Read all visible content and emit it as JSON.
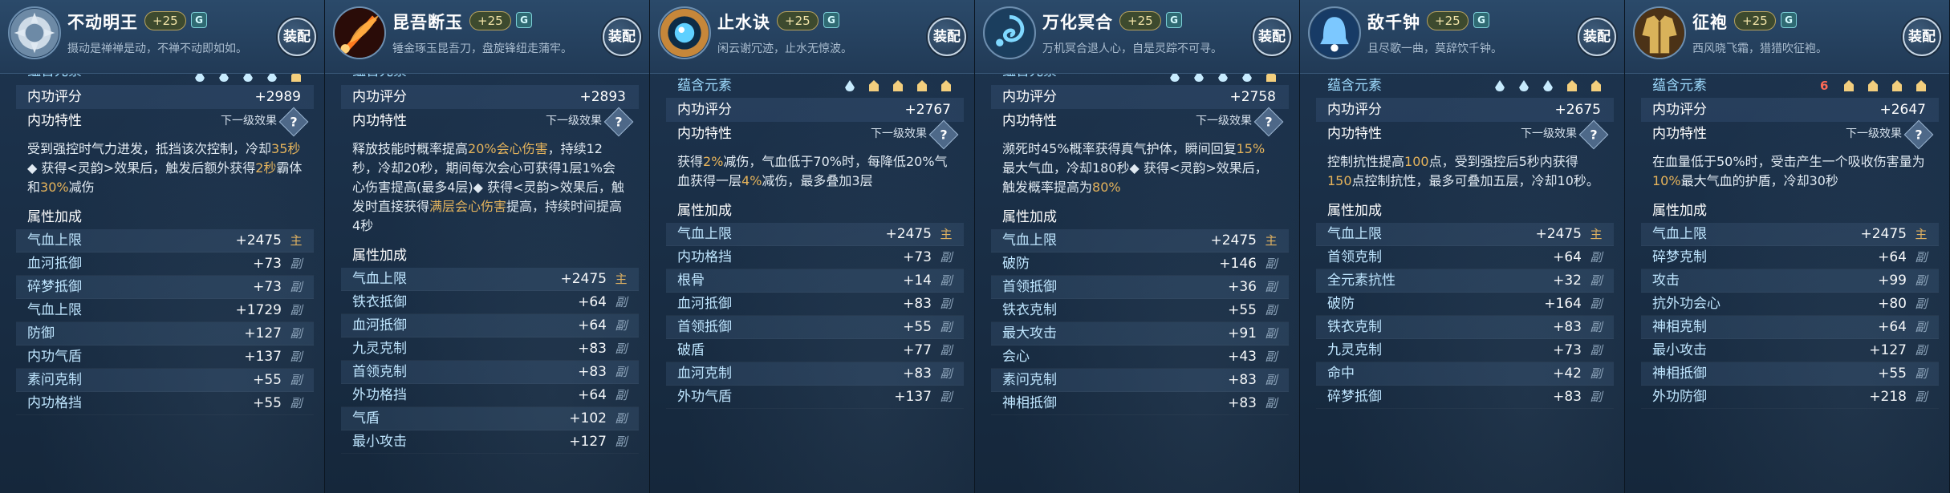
{
  "ui": {
    "equip_label": "装配",
    "element_label": "蕴含元素",
    "score_label": "内功评分",
    "trait_label": "内功特性",
    "next_label": "下一级效果",
    "attr_header": "属性加成",
    "qmark": "?",
    "tag_main": "主",
    "tag_sub": "副"
  },
  "panels": [
    {
      "name": "不动明王",
      "level": "+25",
      "grade": "G",
      "desc": "摄动是禅禅是动，不禅不动即如如。",
      "element_row_visible": false,
      "elements": [
        "water",
        "water",
        "water",
        "water",
        "earth"
      ],
      "score": "+2989",
      "trait": [
        {
          "t": "受到强控时气力进发，抵挡该次控制，冷却"
        },
        {
          "t": "35秒",
          "c": "gold"
        },
        {
          "t": "◆ 获得<灵韵>效果后，触发后额外获得"
        },
        {
          "t": "2秒",
          "c": "gold"
        },
        {
          "t": "霸体和"
        },
        {
          "t": "30%",
          "c": "gold"
        },
        {
          "t": "减伤"
        }
      ],
      "attrs": [
        {
          "name": "气血上限",
          "value": "+2475",
          "tag": "main"
        },
        {
          "name": "血河抵御",
          "value": "+73",
          "tag": "sub"
        },
        {
          "name": "碎梦抵御",
          "value": "+73",
          "tag": "sub"
        },
        {
          "name": "气血上限",
          "value": "+1729",
          "tag": "sub"
        },
        {
          "name": "防御",
          "value": "+127",
          "tag": "sub"
        },
        {
          "name": "内功气盾",
          "value": "+137",
          "tag": "sub"
        },
        {
          "name": "素问克制",
          "value": "+55",
          "tag": "sub"
        },
        {
          "name": "内功格挡",
          "value": "+55",
          "tag": "sub"
        }
      ],
      "icon": "stone-lotus-icon",
      "icon_colors": [
        "#dfe9f2",
        "#6d8aa6"
      ]
    },
    {
      "name": "昆吾断玉",
      "level": "+25",
      "grade": "G",
      "desc": "锤金琢玉昆吾刀，盘旋锋纽走蒲牢。",
      "element_row_visible": false,
      "elements": [],
      "score": "+2893",
      "trait": [
        {
          "t": "释放技能时概率提高"
        },
        {
          "t": "20%会心伤害",
          "c": "gold"
        },
        {
          "t": "，持续12秒，冷却20秒，期间每次会心可获得1层1%会心伤害提高(最多4层)"
        },
        {
          "t": "◆ 获得<灵韵>效果后，触发时直接获得"
        },
        {
          "t": "满层会心伤害",
          "c": "gold"
        },
        {
          "t": "提高，持续时间提高4秒"
        }
      ],
      "attrs": [
        {
          "name": "气血上限",
          "value": "+2475",
          "tag": "main"
        },
        {
          "name": "铁衣抵御",
          "value": "+64",
          "tag": "sub"
        },
        {
          "name": "血河抵御",
          "value": "+64",
          "tag": "sub"
        },
        {
          "name": "九灵克制",
          "value": "+83",
          "tag": "sub"
        },
        {
          "name": "首领克制",
          "value": "+83",
          "tag": "sub"
        },
        {
          "name": "外功格挡",
          "value": "+64",
          "tag": "sub"
        },
        {
          "name": "气盾",
          "value": "+102",
          "tag": "sub"
        },
        {
          "name": "最小攻击",
          "value": "+127",
          "tag": "sub"
        }
      ],
      "icon": "fire-blade-icon",
      "icon_colors": [
        "#ff7a1f",
        "#6a1b10"
      ]
    },
    {
      "name": "止水诀",
      "level": "+25",
      "grade": "G",
      "desc": "闲云谢冗迹，止水无惊波。",
      "element_row_visible": true,
      "elements": [
        "water",
        "earth",
        "earth",
        "earth",
        "earth"
      ],
      "score": "+2767",
      "trait": [
        {
          "t": "获得"
        },
        {
          "t": "2%",
          "c": "gold"
        },
        {
          "t": "减伤，气血低于70%时，每降低20%气血获得一层"
        },
        {
          "t": "4%",
          "c": "gold"
        },
        {
          "t": "减伤，最多叠加3层"
        }
      ],
      "attrs": [
        {
          "name": "气血上限",
          "value": "+2475",
          "tag": "main"
        },
        {
          "name": "内功格挡",
          "value": "+73",
          "tag": "sub"
        },
        {
          "name": "根骨",
          "value": "+14",
          "tag": "sub"
        },
        {
          "name": "血河抵御",
          "value": "+83",
          "tag": "sub"
        },
        {
          "name": "首领抵御",
          "value": "+55",
          "tag": "sub"
        },
        {
          "name": "破盾",
          "value": "+77",
          "tag": "sub"
        },
        {
          "name": "血河克制",
          "value": "+83",
          "tag": "sub"
        },
        {
          "name": "外功气盾",
          "value": "+137",
          "tag": "sub"
        }
      ],
      "icon": "water-orb-icon",
      "icon_colors": [
        "#5fd0ff",
        "#c6873a"
      ]
    },
    {
      "name": "万化冥合",
      "level": "+25",
      "grade": "G",
      "desc": "万机冥合退人心，自是灵踪不可寻。",
      "element_row_visible": false,
      "elements": [
        "water",
        "water",
        "water",
        "water",
        "earth"
      ],
      "score": "+2758",
      "trait": [
        {
          "t": "濒死时45%概率获得真气护体，瞬间回复"
        },
        {
          "t": "15%",
          "c": "gold"
        },
        {
          "t": "最大气血，冷却180秒"
        },
        {
          "t": "◆ 获得<灵韵>效果后，触发概率提高为"
        },
        {
          "t": "80%",
          "c": "gold"
        }
      ],
      "attrs": [
        {
          "name": "气血上限",
          "value": "+2475",
          "tag": "main"
        },
        {
          "name": "破防",
          "value": "+146",
          "tag": "sub"
        },
        {
          "name": "首领抵御",
          "value": "+36",
          "tag": "sub"
        },
        {
          "name": "铁衣克制",
          "value": "+55",
          "tag": "sub"
        },
        {
          "name": "最大攻击",
          "value": "+91",
          "tag": "sub"
        },
        {
          "name": "会心",
          "value": "+43",
          "tag": "sub"
        },
        {
          "name": "素问克制",
          "value": "+83",
          "tag": "sub"
        },
        {
          "name": "神相抵御",
          "value": "+83",
          "tag": "sub"
        }
      ],
      "icon": "spirit-swirl-icon",
      "icon_colors": [
        "#7fd8ff",
        "#1b3e5e"
      ]
    },
    {
      "name": "敌千钟",
      "level": "+25",
      "grade": "G",
      "desc": "且尽歌一曲，莫辞饮千钟。",
      "element_row_visible": true,
      "elements": [
        "water",
        "water",
        "water",
        "earth",
        "earth"
      ],
      "score": "+2675",
      "trait": [
        {
          "t": "控制抗性提高"
        },
        {
          "t": "100",
          "c": "gold"
        },
        {
          "t": "点，受到强控后5秒内获得"
        },
        {
          "t": "150",
          "c": "gold"
        },
        {
          "t": "点控制抗性，最多可叠加五层，冷却10秒。"
        }
      ],
      "attrs": [
        {
          "name": "气血上限",
          "value": "+2475",
          "tag": "main"
        },
        {
          "name": "首领克制",
          "value": "+64",
          "tag": "sub"
        },
        {
          "name": "全元素抗性",
          "value": "+32",
          "tag": "sub"
        },
        {
          "name": "破防",
          "value": "+164",
          "tag": "sub"
        },
        {
          "name": "铁衣克制",
          "value": "+83",
          "tag": "sub"
        },
        {
          "name": "九灵克制",
          "value": "+73",
          "tag": "sub"
        },
        {
          "name": "命中",
          "value": "+42",
          "tag": "sub"
        },
        {
          "name": "碎梦抵御",
          "value": "+83",
          "tag": "sub"
        }
      ],
      "icon": "bell-icon",
      "icon_colors": [
        "#7cc8ff",
        "#173b66"
      ]
    },
    {
      "name": "征袍",
      "level": "+25",
      "grade": "G",
      "desc": "西风晓飞霜，猎猎吹征袍。",
      "element_row_visible": true,
      "elements": [
        "six",
        "earth",
        "earth",
        "earth",
        "earth"
      ],
      "score": "+2647",
      "trait": [
        {
          "t": "在血量低于50%时，受击产生一个吸收伤害量为"
        },
        {
          "t": "10%",
          "c": "gold"
        },
        {
          "t": "最大气血的护盾，冷却30秒"
        }
      ],
      "attrs": [
        {
          "name": "气血上限",
          "value": "+2475",
          "tag": "main"
        },
        {
          "name": "碎梦克制",
          "value": "+64",
          "tag": "sub"
        },
        {
          "name": "攻击",
          "value": "+99",
          "tag": "sub"
        },
        {
          "name": "抗外功会心",
          "value": "+80",
          "tag": "sub"
        },
        {
          "name": "神相克制",
          "value": "+64",
          "tag": "sub"
        },
        {
          "name": "最小攻击",
          "value": "+127",
          "tag": "sub"
        },
        {
          "name": "神相抵御",
          "value": "+55",
          "tag": "sub"
        },
        {
          "name": "外功防御",
          "value": "+218",
          "tag": "sub"
        }
      ],
      "icon": "armor-robe-icon",
      "icon_colors": [
        "#d9b25a",
        "#4b3217"
      ]
    }
  ]
}
